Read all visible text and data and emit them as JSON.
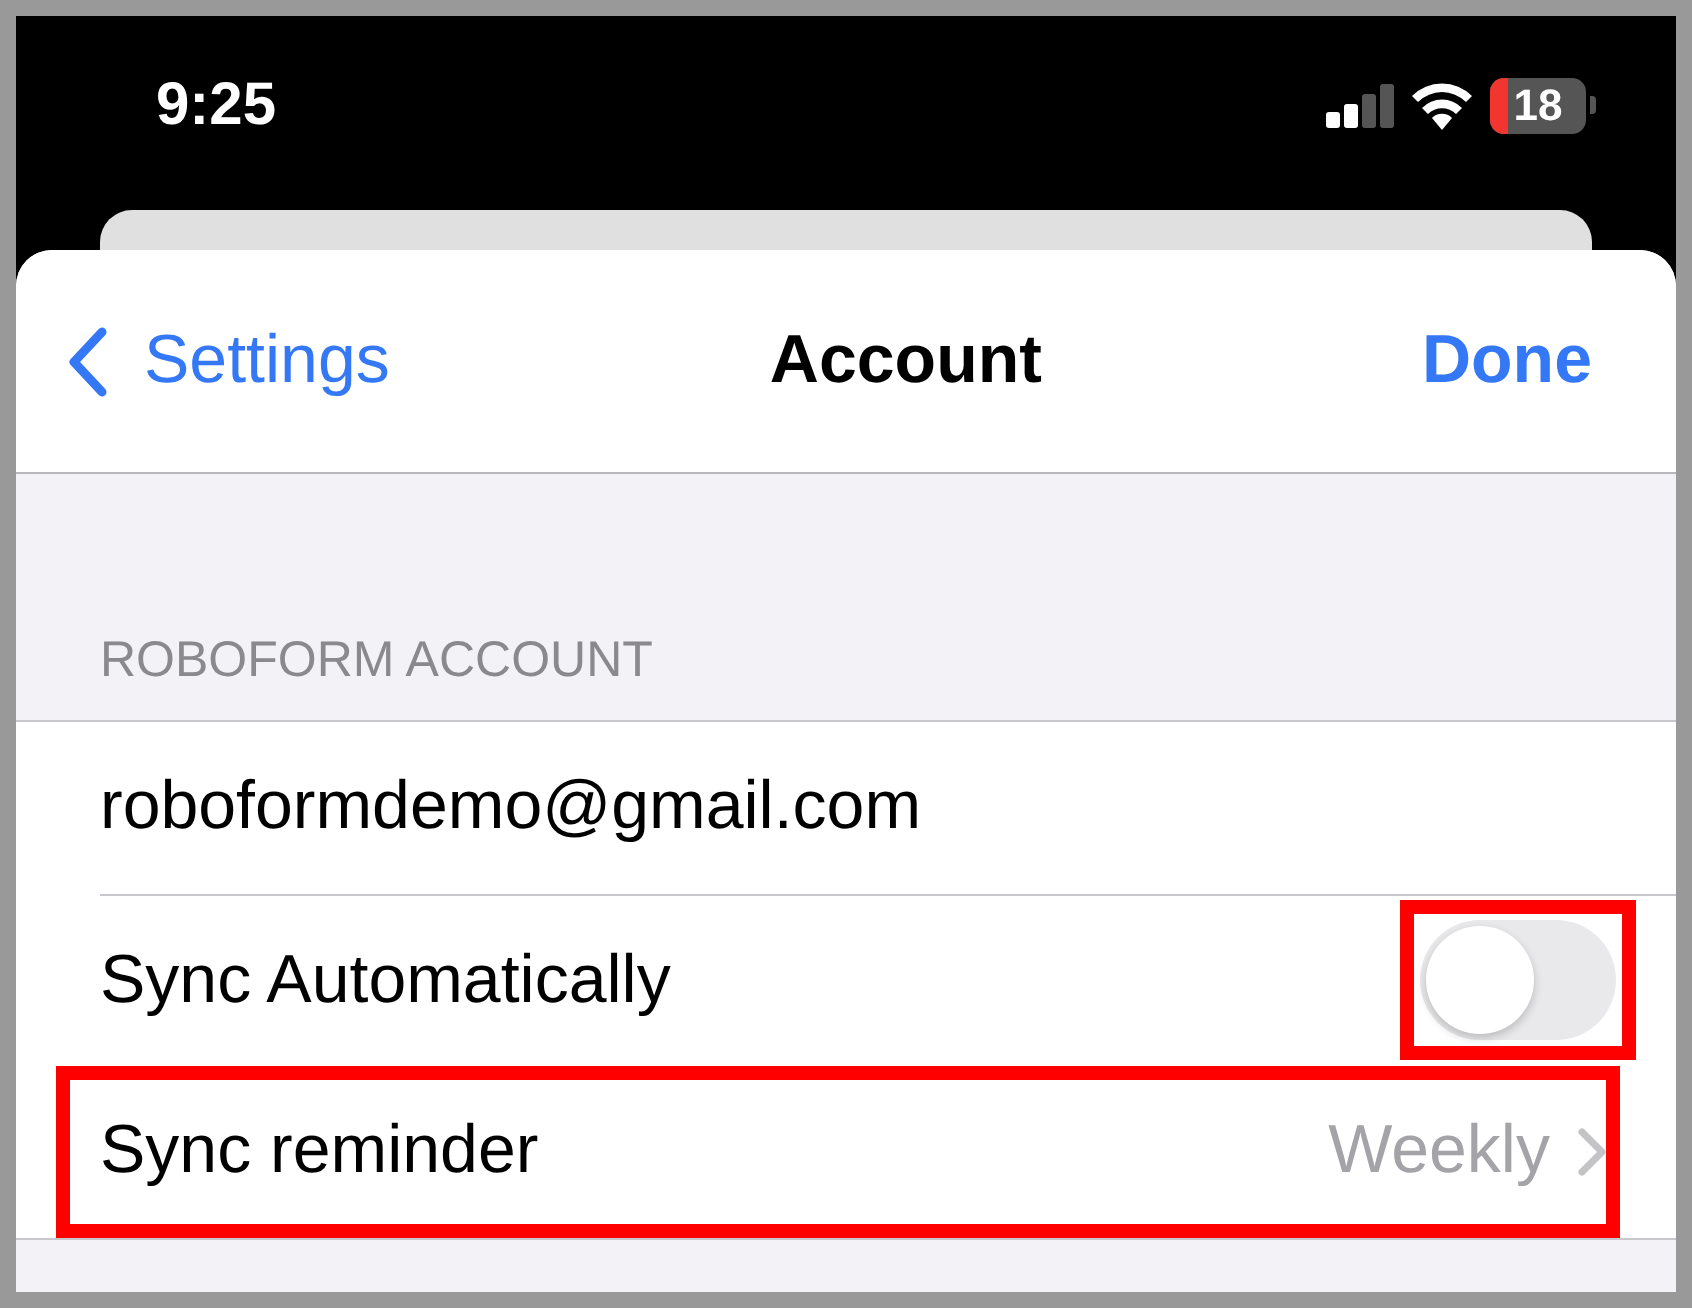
{
  "status_bar": {
    "time": "9:25",
    "battery": "18"
  },
  "nav_bar": {
    "back": "Settings",
    "title": "Account",
    "action": "Done"
  },
  "section": {
    "header": "ROBOFORM ACCOUNT",
    "rows": [
      {
        "kind": "text",
        "label": "roboformdemo@gmail.com",
        "highlighted": false
      },
      {
        "kind": "toggle",
        "label": "Sync Automatically",
        "on": false,
        "highlighted": true
      },
      {
        "kind": "link",
        "label": "Sync reminder",
        "value": "Weekly",
        "highlighted": true
      }
    ]
  }
}
